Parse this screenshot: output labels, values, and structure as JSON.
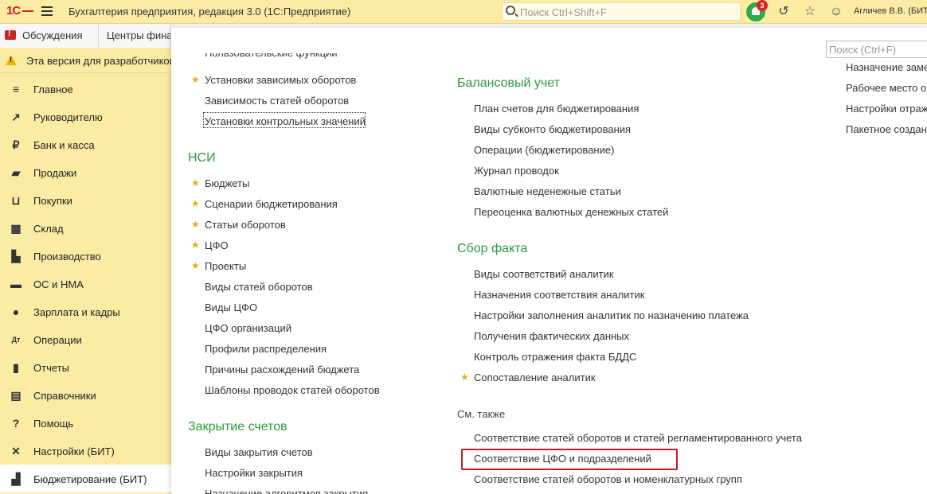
{
  "app": {
    "title": "Бухгалтерия предприятия, редакция 3.0  (1С:Предприятие)",
    "logo": "1С",
    "search_placeholder": "Поиск Ctrl+Shift+F",
    "notifications_count": "3",
    "user": "Агличев В.В. (БИТ"
  },
  "tabs": [
    {
      "label": "Обсуждения"
    },
    {
      "label": "Центры фина"
    }
  ],
  "warning": "Эта версия для разработчиков",
  "sidebar": [
    {
      "label": "Главное",
      "icon": "≡"
    },
    {
      "label": "Руководителю",
      "icon": "↗"
    },
    {
      "label": "Банк и касса",
      "icon": "₽"
    },
    {
      "label": "Продажи",
      "icon": "▰"
    },
    {
      "label": "Покупки",
      "icon": "⊔"
    },
    {
      "label": "Склад",
      "icon": "▦"
    },
    {
      "label": "Производство",
      "icon": "▙"
    },
    {
      "label": "ОС и НМА",
      "icon": "▬"
    },
    {
      "label": "Зарплата и кадры",
      "icon": "●"
    },
    {
      "label": "Операции",
      "icon": "Дт"
    },
    {
      "label": "Отчеты",
      "icon": "▮"
    },
    {
      "label": "Справочники",
      "icon": "▤"
    },
    {
      "label": "Помощь",
      "icon": "?"
    },
    {
      "label": "Настройки (БИТ)",
      "icon": "✕"
    },
    {
      "label": "Бюджетирование (БИТ)",
      "icon": "▟"
    }
  ],
  "panel": {
    "search_placeholder": "Поиск (Ctrl+F)",
    "col1": {
      "top_links": [
        "Пользовательские функции",
        "Установки зависимых оборотов",
        "Зависимость статей оборотов",
        "Установки контрольных значений"
      ],
      "nsi_title": "НСИ",
      "nsi_links": [
        "Бюджеты",
        "Сценарии бюджетирования",
        "Статьи оборотов",
        "ЦФО",
        "Проекты",
        "Виды статей оборотов",
        "Виды  ЦФО",
        "ЦФО организаций",
        "Профили распределения",
        "Причины расхождений бюджета",
        "Шаблоны проводок статей оборотов"
      ],
      "closing_title": "Закрытие счетов",
      "closing_links": [
        "Виды закрытия счетов",
        "Настройки закрытия",
        "Назначение алгоритмов закрытия"
      ]
    },
    "col2": {
      "balance_title": "Балансовый учет",
      "balance_links": [
        "План счетов для бюджетирования",
        "Виды субконто бюджетирования",
        "Операции (бюджетирование)",
        "Журнал проводок",
        "Валютные неденежные статьи",
        "Переоценка валютных денежных статей"
      ],
      "fact_title": "Сбор факта",
      "fact_links": [
        "Виды соответствий аналитик",
        "Назначения соответствия аналитик",
        "Настройки заполнения аналитик по назначению платежа",
        "Получения фактических данных",
        "Контроль отражения факта БДДС",
        "Сопоставление аналитик"
      ],
      "see_also": "См. также",
      "see_also_links": [
        "Соответствие статей оборотов и статей регламентированного учета",
        "Соответствие ЦФО и подразделений",
        "Соответствие статей оборотов и номенклатурных групп"
      ]
    },
    "col3": {
      "links": [
        "Назначение заме",
        "Рабочее место о",
        "Настройки отраж",
        "Пакетное создан"
      ]
    }
  }
}
